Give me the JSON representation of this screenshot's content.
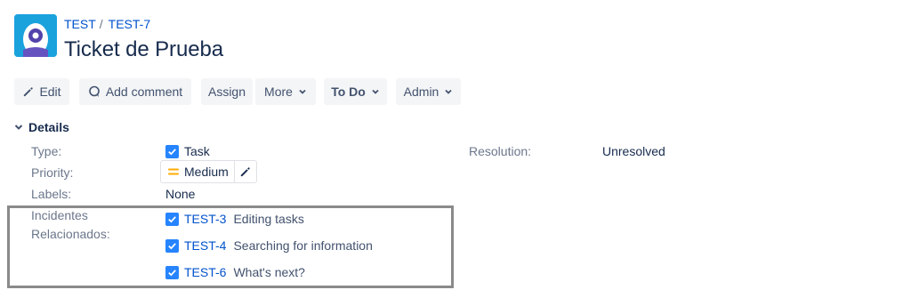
{
  "breadcrumb": {
    "project": "TEST",
    "separator": "/",
    "issue_key": "TEST-7"
  },
  "issue": {
    "title": "Ticket de Prueba"
  },
  "toolbar": {
    "edit": "Edit",
    "add_comment": "Add comment",
    "assign": "Assign",
    "more": "More",
    "status": "To Do",
    "admin": "Admin"
  },
  "details": {
    "heading": "Details",
    "type_label": "Type:",
    "type_value": "Task",
    "priority_label": "Priority:",
    "priority_value": "Medium",
    "labels_label": "Labels:",
    "labels_value": "None",
    "resolution_label": "Resolution:",
    "resolution_value": "Unresolved",
    "related_label_line1": "Incidentes",
    "related_label_line2": "Relacionados:",
    "related": [
      {
        "key": "TEST-3",
        "summary": "Editing tasks"
      },
      {
        "key": "TEST-4",
        "summary": "Searching for information"
      },
      {
        "key": "TEST-6",
        "summary": "What's next?"
      }
    ]
  },
  "colors": {
    "link": "#0052cc",
    "task_icon": "#2684ff",
    "priority_medium": "#ffab00",
    "highlight_border": "#8a8a8a"
  }
}
